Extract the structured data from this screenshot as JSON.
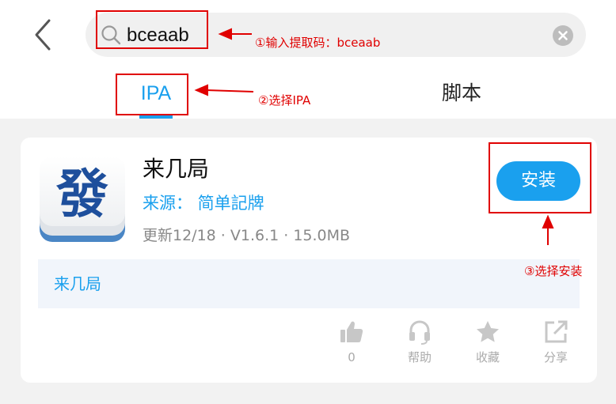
{
  "search": {
    "query": "bceaab"
  },
  "tabs": [
    {
      "label": "IPA",
      "active": true
    },
    {
      "label": "脚本",
      "active": false
    }
  ],
  "app": {
    "name": "来几局",
    "source": "来源： 简单記牌",
    "meta": "更新12/18 · V1.6.1 · 15.0MB",
    "install_label": "安装",
    "description": "来几局",
    "icon_glyph": "發"
  },
  "actions": [
    {
      "icon": "thumbs-up-icon",
      "label": "0"
    },
    {
      "icon": "headset-icon",
      "label": "帮助"
    },
    {
      "icon": "star-icon",
      "label": "收藏"
    },
    {
      "icon": "share-icon",
      "label": "分享"
    }
  ],
  "annotations": {
    "step1": "①输入提取码：bceaab",
    "step2": "②选择IPA",
    "step3": "③选择安装"
  },
  "colors": {
    "accent": "#1aa0ee",
    "annotation": "#e00000",
    "background": "#f2f2f2"
  }
}
